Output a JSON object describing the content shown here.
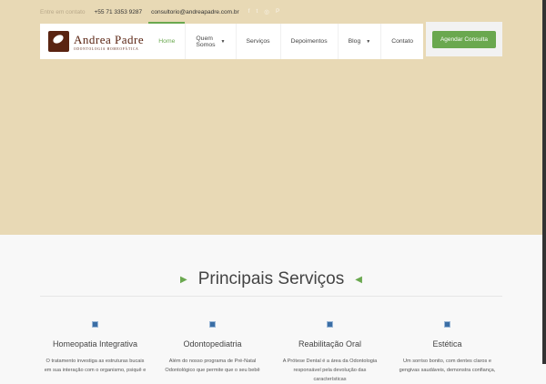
{
  "topbar": {
    "contact_label": "Entre em contato",
    "phone": "+55 71 3353 9287",
    "email": "consultorio@andreapadre.com.br"
  },
  "logo": {
    "name": "Andrea Padre",
    "subtitle": "ODONTOLOGIA HOMEOPÁTICA"
  },
  "menu": [
    {
      "label": "Home",
      "active": true
    },
    {
      "label": "Quem Somos",
      "dropdown": true
    },
    {
      "label": "Serviços"
    },
    {
      "label": "Depoimentos"
    },
    {
      "label": "Blog",
      "dropdown": true
    },
    {
      "label": "Contato"
    }
  ],
  "cta": "Agendar Consulta",
  "section": {
    "title": "Principais Serviços"
  },
  "services": [
    {
      "title": "Homeopatia Integrativa",
      "text": "O tratamento investiga as estruturas bucais em sua interação com o organismo, psiquê e"
    },
    {
      "title": "Odontopediatria",
      "text": "Além do nosso programa de Pré-Natal Odontológico que permite que o seu bebê"
    },
    {
      "title": "Reabilitação Oral",
      "text": "A Prótese Dental é a área da Odontologia responsável pela devolução das características"
    },
    {
      "title": "Estética",
      "text": "Um sorriso bonito, com dentes claros e gengivas saudáveis, demonstra confiança,"
    }
  ]
}
